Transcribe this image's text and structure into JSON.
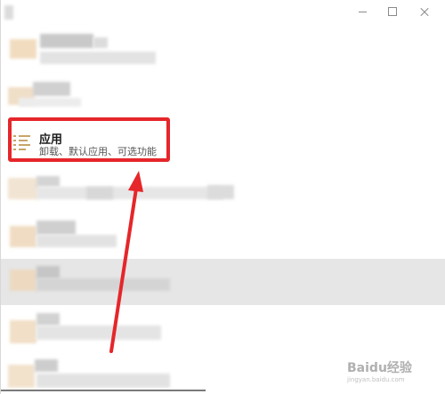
{
  "window": {
    "controls": [
      "minimize",
      "maximize",
      "close"
    ]
  },
  "apps_item": {
    "title": "应用",
    "description": "卸载、默认应用、可选功能",
    "icon": "apps-list-icon",
    "highlight_color": "#e5262a"
  },
  "annotation": {
    "arrow_color": "#e5262a"
  },
  "watermark": {
    "brand": "Baidu经验",
    "subtitle": "jingyan.baidu.com"
  },
  "colors": {
    "selected_row": "#e6e6e6",
    "icon_accent": "#c8a46a"
  }
}
